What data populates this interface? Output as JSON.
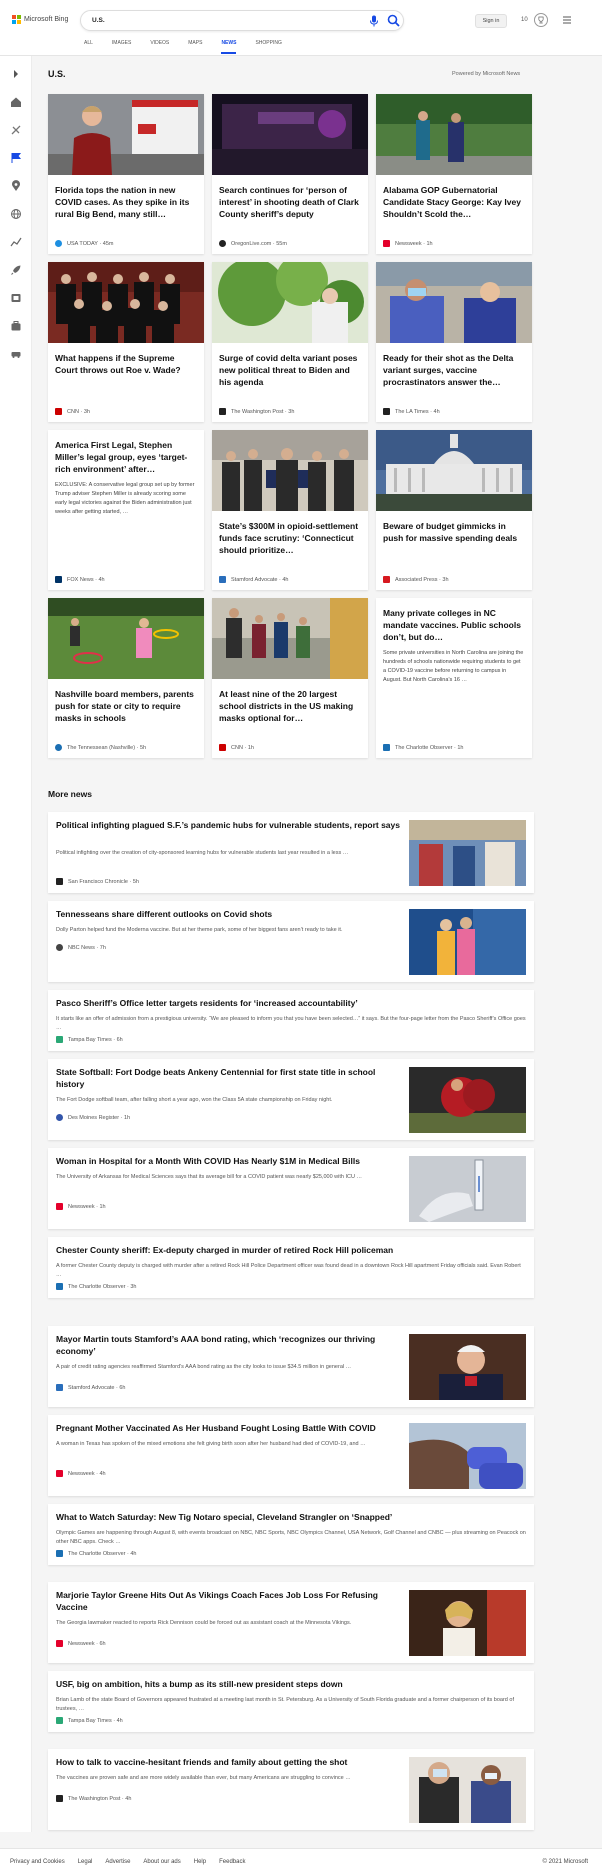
{
  "header": {
    "brand": "Microsoft Bing",
    "search_value": "U.S.",
    "signin": "Sign in",
    "rewards_count": "10",
    "tabs": [
      "ALL",
      "IMAGES",
      "VIDEOS",
      "MAPS",
      "NEWS",
      "SHOPPING"
    ],
    "active_tab": "NEWS",
    "accent": "#174ae4"
  },
  "section": {
    "title": "U.S.",
    "powered": "Powered by Microsoft News"
  },
  "cards": [
    {
      "title": "Florida tops the nation in new COVID cases. As they spike in its rural Big Bend, many still…",
      "source": "USA TODAY",
      "time": "45m",
      "icon_color": "#1d8fe1"
    },
    {
      "title": "Search continues for ‘person of interest’ in shooting death of Clark County sheriff’s deputy",
      "source": "OregonLive.com",
      "time": "55m",
      "icon_color": "#222222"
    },
    {
      "title": "Alabama GOP Gubernatorial Candidate Stacy George: Kay Ivey Shouldn’t Scold the…",
      "source": "Newsweek",
      "time": "1h",
      "icon_color": "#e4002b"
    },
    {
      "title": "What happens if the Supreme Court throws out Roe v. Wade?",
      "source": "CNN",
      "time": "3h",
      "icon_color": "#cc0000"
    },
    {
      "title": "Surge of covid delta variant poses new political threat to Biden and his agenda",
      "source": "The Washington Post",
      "time": "3h",
      "icon_color": "#222222"
    },
    {
      "title": "Ready for their shot as the Delta variant surges, vaccine procrastinators answer the…",
      "source": "The LA Times",
      "time": "4h",
      "icon_color": "#222222"
    },
    {
      "title": "America First Legal, Stephen Miller’s legal group, eyes ‘target-rich environment’ after…",
      "snippet": "EXCLUSIVE: A conservative legal group set up by former Trump adviser Stephen Miller is already scoring some early legal victories against the Biden administration just weeks after getting started, …",
      "source": "FOX News",
      "time": "4h",
      "icon_color": "#003366"
    },
    {
      "title": "State’s $300M in opioid-settlement funds face scrutiny: ‘Connecticut should prioritize…",
      "source": "Stamford Advocate",
      "time": "4h",
      "icon_color": "#2a6ebb"
    },
    {
      "title": "Beware of budget gimmicks in push for massive spending deals",
      "source": "Associated Press",
      "time": "3h",
      "icon_color": "#d71920"
    },
    {
      "title": "Nashville board members, parents push for state or city to require masks in schools",
      "source": "The Tennessean (Nashville)",
      "time": "5h",
      "icon_color": "#1b6fb3"
    },
    {
      "title": "At least nine of the 20 largest school districts in the US making masks optional for…",
      "source": "CNN",
      "time": "1h",
      "icon_color": "#cc0000"
    },
    {
      "title": "Many private colleges in NC mandate vaccines. Public schools don’t, but do…",
      "snippet": "Some private universities in North Carolina are joining the hundreds of schools nationwide requiring students to get a COVID-19 vaccine before returning to campus in August. But North Carolina’s 16 …",
      "source": "The Charlotte Observer",
      "time": "1h",
      "icon_color": "#1b6fb3"
    }
  ],
  "more_news": {
    "title": "More news",
    "items": [
      {
        "title": "Political infighting plagued S.F.’s pandemic hubs for vulnerable students, report says",
        "snippet": "Political infighting over the creation of city-sponsored learning hubs for vulnerable students last year resulted in a less …",
        "source": "San Francisco Chronicle",
        "time": "5h",
        "icon_color": "#222222"
      },
      {
        "title": "Tennesseans share different outlooks on Covid shots",
        "snippet": "Dolly Parton helped fund the Moderna vaccine. But at her theme park, some of her biggest fans aren’t ready to take it.",
        "source": "NBC News",
        "time": "7h",
        "icon_color": "#444444"
      },
      {
        "title": "Pasco Sheriff’s Office letter targets residents for ‘increased accountability’",
        "snippet": "It starts like an offer of admission from a prestigious university. “We are pleased to inform you that you have been selected…” it says. But the four-page letter from the Pasco Sheriff’s Office goes …",
        "source": "Tampa Bay Times",
        "time": "6h",
        "icon_color": "#2aa876"
      },
      {
        "title": "State Softball: Fort Dodge beats Ankeny Centennial for first state title in school history",
        "snippet": "The Fort Dodge softball team, after falling short a year ago, won the Class 5A state championship on Friday night.",
        "source": "Des Moines Register",
        "time": "1h",
        "icon_color": "#3355aa"
      },
      {
        "title": "Woman in Hospital for a Month With COVID Has Nearly $1M in Medical Bills",
        "snippet": "The University of Arkansas for Medical Sciences says that its average bill for a COVID patient was nearly $25,000 with ICU …",
        "source": "Newsweek",
        "time": "1h",
        "icon_color": "#e4002b"
      },
      {
        "title": "Chester County sheriff: Ex-deputy charged in murder of retired Rock Hill policeman",
        "snippet": "A former Chester County deputy is charged with murder after a retired Rock Hill Police Department officer was found dead in a downtown Rock Hill apartment Friday officials said. Evan Robert …",
        "source": "The Charlotte Observer",
        "time": "3h",
        "icon_color": "#1b6fb3"
      },
      {
        "title": "Mayor Martin touts Stamford’s AAA bond rating, which ‘recognizes our thriving economy’",
        "snippet": "A pair of credit rating agencies reaffirmed Stamford’s AAA bond rating as the city looks to issue $34.5 million in general …",
        "source": "Stamford Advocate",
        "time": "6h",
        "icon_color": "#2a6ebb"
      },
      {
        "title": "Pregnant Mother Vaccinated As Her Husband Fought Losing Battle With COVID",
        "snippet": "A woman in Texas has spoken of the mixed emotions she felt giving birth soon after her husband had died of COVID-19, and …",
        "source": "Newsweek",
        "time": "4h",
        "icon_color": "#e4002b"
      },
      {
        "title": "What to Watch Saturday: New Tig Notaro special, Cleveland Strangler on ‘Snapped’",
        "snippet": "Olympic Games are happening through August 8, with events broadcast on NBC, NBC Sports, NBC Olympics Channel, USA Network, Golf Channel and CNBC — plus streaming on Peacock on other NBC apps. Check …",
        "source": "The Charlotte Observer",
        "time": "4h",
        "icon_color": "#1b6fb3"
      },
      {
        "title": "Marjorie Taylor Greene Hits Out As Vikings Coach Faces Job Loss For Refusing Vaccine",
        "snippet": "The Georgia lawmaker reacted to reports Rick Dennison could be forced out as assistant coach at the Minnesota Vikings.",
        "source": "Newsweek",
        "time": "6h",
        "icon_color": "#e4002b"
      },
      {
        "title": "USF, big on ambition, hits a bump as its still-new president steps down",
        "snippet": "Brian Lamb of the state Board of Governors appeared frustrated at a meeting last month in St. Petersburg. As a University of South Florida graduate and a former chairperson of its board of trustees, …",
        "source": "Tampa Bay Times",
        "time": "4h",
        "icon_color": "#2aa876"
      },
      {
        "title": "How to talk to vaccine-hesitant friends and family about getting the shot",
        "snippet": "The vaccines are proven safe and are more widely available than ever, but many Americans are struggling to convince …",
        "source": "The Washington Post",
        "time": "4h",
        "icon_color": "#222222"
      }
    ]
  },
  "footer": {
    "links": [
      "Privacy and Cookies",
      "Legal",
      "Advertise",
      "About our ads",
      "Help",
      "Feedback"
    ],
    "copyright": "© 2021 Microsoft"
  }
}
